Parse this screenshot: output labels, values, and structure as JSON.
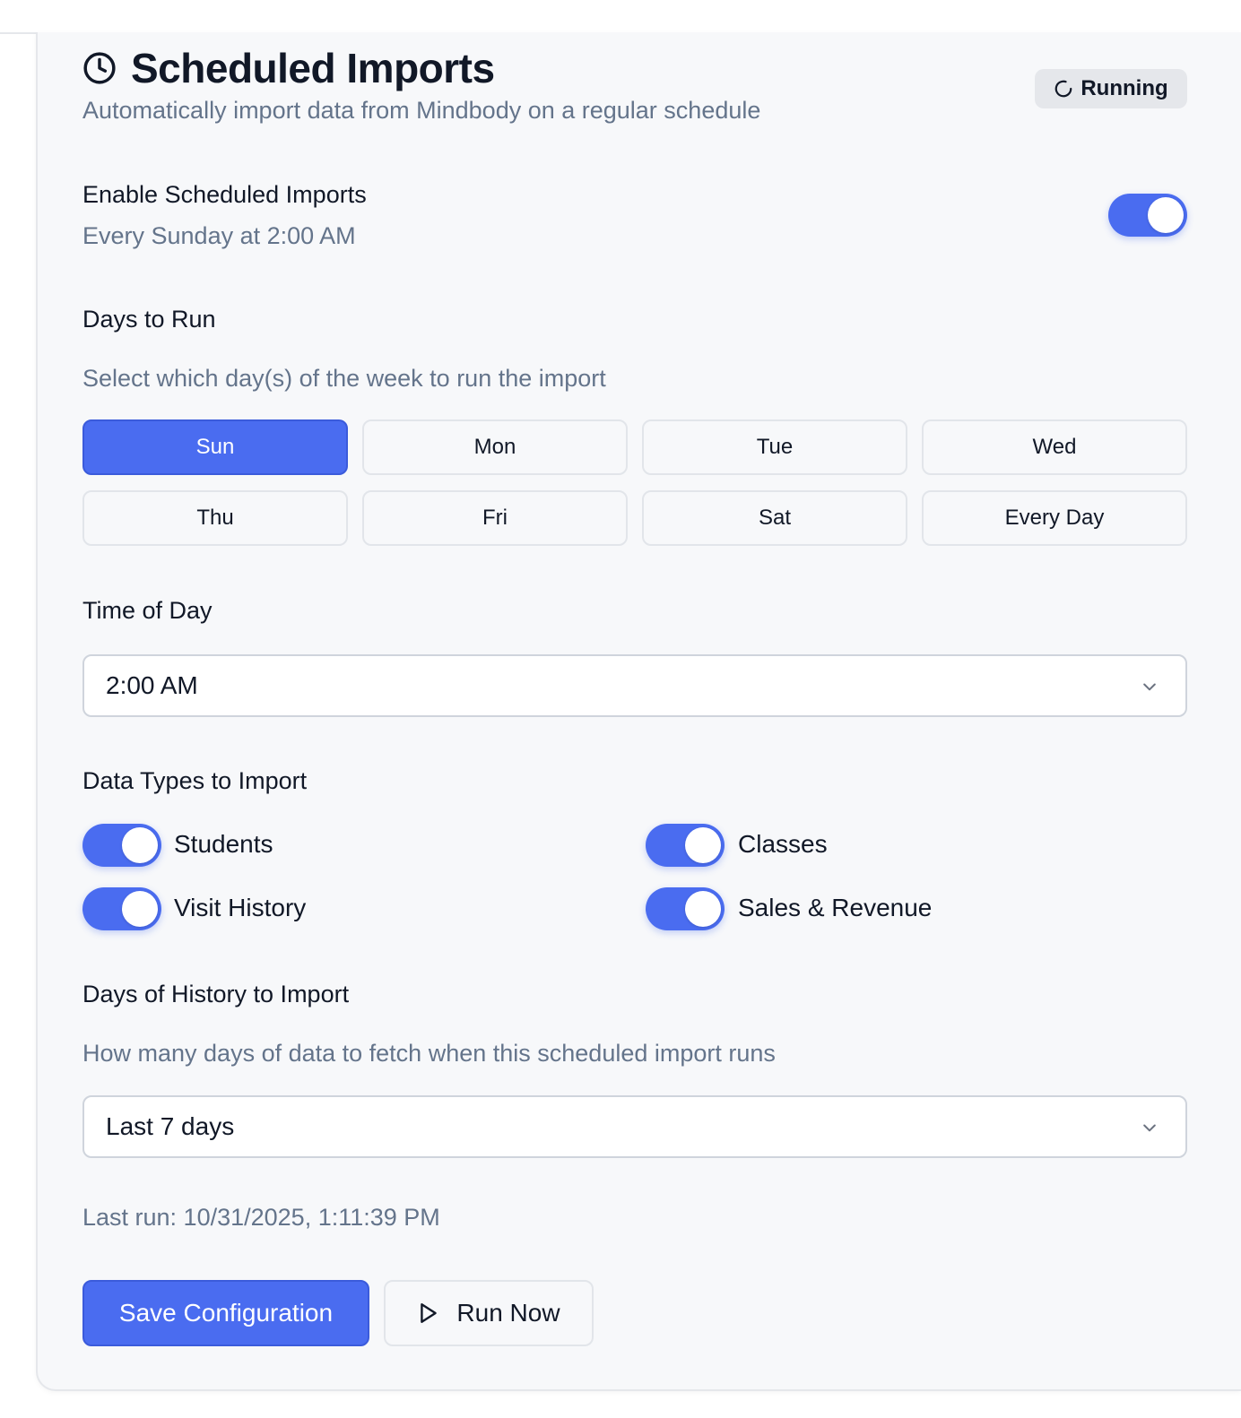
{
  "header": {
    "title": "Scheduled Imports",
    "subtitle": "Automatically import data from Mindbody on a regular schedule",
    "status_badge": "Running",
    "title_icon": "clock-icon",
    "status_icon": "spinner-icon"
  },
  "enable": {
    "label": "Enable Scheduled Imports",
    "summary": "Every Sunday at 2:00 AM",
    "enabled": true
  },
  "days": {
    "label": "Days to Run",
    "help": "Select which day(s) of the week to run the import",
    "options": [
      "Sun",
      "Mon",
      "Tue",
      "Wed",
      "Thu",
      "Fri",
      "Sat",
      "Every Day"
    ],
    "selected": "Sun"
  },
  "time": {
    "label": "Time of Day",
    "value": "2:00 AM"
  },
  "data_types": {
    "label": "Data Types to Import",
    "items": [
      {
        "label": "Students",
        "enabled": true
      },
      {
        "label": "Classes",
        "enabled": true
      },
      {
        "label": "Visit History",
        "enabled": true
      },
      {
        "label": "Sales & Revenue",
        "enabled": true
      }
    ]
  },
  "history": {
    "label": "Days of History to Import",
    "help": "How many days of data to fetch when this scheduled import runs",
    "value": "Last 7 days"
  },
  "last_run": "Last run: 10/31/2025, 1:11:39 PM",
  "actions": {
    "save_label": "Save Configuration",
    "run_label": "Run Now"
  },
  "colors": {
    "accent": "#4a6cf0",
    "muted_text": "#64748b",
    "card_bg": "#f7f8fa"
  }
}
